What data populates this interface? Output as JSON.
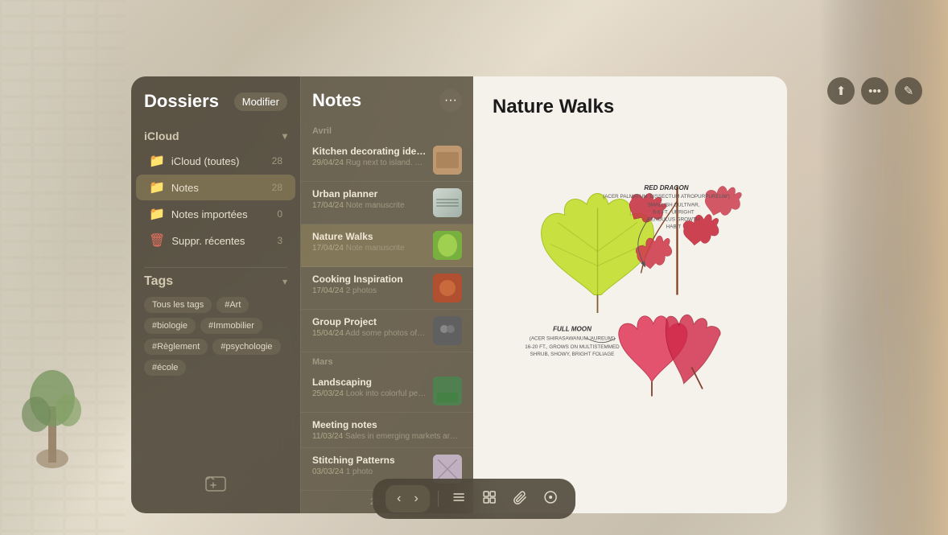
{
  "sidebar": {
    "title": "Dossiers",
    "modifier_label": "Modifier",
    "icloud_section": "iCloud",
    "folders": [
      {
        "name": "iCloud (toutes)",
        "count": 28,
        "icon": "📁",
        "active": false,
        "trash": false
      },
      {
        "name": "Notes",
        "count": 28,
        "icon": "📁",
        "active": true,
        "trash": false
      },
      {
        "name": "Notes importées",
        "count": 0,
        "icon": "📁",
        "active": false,
        "trash": false
      },
      {
        "name": "Suppr. récentes",
        "count": 3,
        "icon": "🗑",
        "active": false,
        "trash": true
      }
    ],
    "tags_title": "Tags",
    "tags": [
      "Tous les tags",
      "#Art",
      "#biologie",
      "#Immobilier",
      "#Règlement",
      "#psychologie",
      "#école"
    ],
    "new_folder_icon": "⊞"
  },
  "notes_panel": {
    "title": "Notes",
    "menu_icon": "•••",
    "sections": [
      {
        "label": "Avril",
        "notes": [
          {
            "title": "Kitchen decorating ideas",
            "date": "29/04/24",
            "preview": "Rug next to island. Cont...",
            "has_thumb": true,
            "thumb_type": "kitchen"
          },
          {
            "title": "Urban planner",
            "date": "17/04/24",
            "preview": "Note manuscrite",
            "has_thumb": true,
            "thumb_type": "urban"
          },
          {
            "title": "Nature Walks",
            "date": "17/04/24",
            "preview": "Note manuscrite",
            "has_thumb": true,
            "thumb_type": "nature",
            "active": true
          },
          {
            "title": "Cooking Inspiration",
            "date": "17/04/24",
            "preview": "2 photos",
            "has_thumb": true,
            "thumb_type": "cooking"
          },
          {
            "title": "Group Project",
            "date": "15/04/24",
            "preview": "Add some photos of the...",
            "has_thumb": true,
            "thumb_type": "group"
          }
        ]
      },
      {
        "label": "Mars",
        "notes": [
          {
            "title": "Landscaping",
            "date": "25/03/24",
            "preview": "Look into colorful peren...",
            "has_thumb": true,
            "thumb_type": "land"
          },
          {
            "title": "Meeting notes",
            "date": "11/03/24",
            "preview": "Sales in emerging markets are t...",
            "has_thumb": false
          },
          {
            "title": "Stitching Patterns",
            "date": "03/03/24",
            "preview": "1 photo",
            "has_thumb": true,
            "thumb_type": "stitch"
          }
        ]
      }
    ],
    "footer": "28 notes"
  },
  "note_detail": {
    "title": "Nature Walks",
    "annotations": [
      {
        "label": "RED DRAGON",
        "sub": "(ACER PALMATUM 'DISSECTUM ATROPURPUREUM')",
        "detail": "SMALLISH CULTIVAR, 6-8 FT., UPRIGHT PENDULUS GROWTH HABIT"
      },
      {
        "label": "FULL MOON",
        "sub": "(ACER SHIRASAWANUM 'AUREUM')",
        "detail": "16-20 FT., GROWS ON MULTISTEMMED SHRUB, SHOWY, BRIGHT FOLIAGE"
      }
    ]
  },
  "header_controls": {
    "share_icon": "⬆",
    "more_icon": "•••",
    "compose_icon": "✎"
  },
  "bottom_toolbar": {
    "back_icon": "‹",
    "forward_icon": "›",
    "list_icon": "≡",
    "grid_icon": "⊞",
    "attach_icon": "🔗",
    "nav_icon": "⊙"
  }
}
